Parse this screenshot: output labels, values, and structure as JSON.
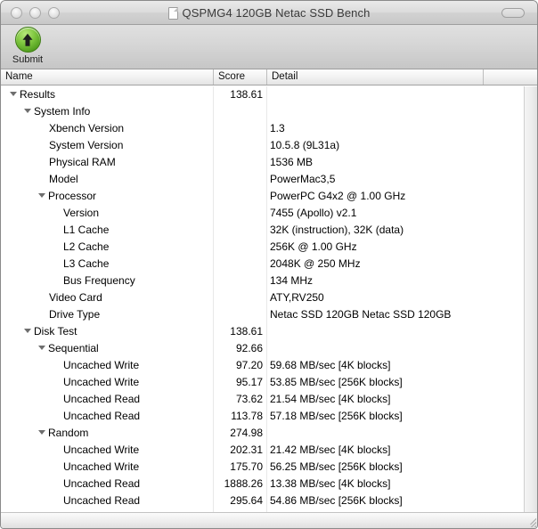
{
  "window": {
    "title": "QSPMG4 120GB Netac SSD Bench",
    "doc_icon": "document-icon",
    "traffic_lights": [
      "close",
      "minimize",
      "zoom"
    ],
    "toolbar_toggle_icon": "toolbar-toggle-icon"
  },
  "toolbar": {
    "submit_label": "Submit",
    "submit_icon": "upload-arrow-icon"
  },
  "columns": {
    "name": "Name",
    "score": "Score",
    "detail": "Detail"
  },
  "rows": [
    {
      "level": 0,
      "expanded": true,
      "name": "Results",
      "score": "138.61",
      "detail": ""
    },
    {
      "level": 1,
      "expanded": true,
      "name": "System Info",
      "score": "",
      "detail": ""
    },
    {
      "level": 2,
      "expanded": null,
      "name": "Xbench Version",
      "score": "",
      "detail": "1.3"
    },
    {
      "level": 2,
      "expanded": null,
      "name": "System Version",
      "score": "",
      "detail": "10.5.8 (9L31a)"
    },
    {
      "level": 2,
      "expanded": null,
      "name": "Physical RAM",
      "score": "",
      "detail": "1536 MB"
    },
    {
      "level": 2,
      "expanded": null,
      "name": "Model",
      "score": "",
      "detail": "PowerMac3,5"
    },
    {
      "level": 2,
      "expanded": true,
      "name": "Processor",
      "score": "",
      "detail": "PowerPC G4x2 @ 1.00 GHz"
    },
    {
      "level": 3,
      "expanded": null,
      "name": "Version",
      "score": "",
      "detail": "7455 (Apollo) v2.1"
    },
    {
      "level": 3,
      "expanded": null,
      "name": "L1 Cache",
      "score": "",
      "detail": "32K (instruction), 32K (data)"
    },
    {
      "level": 3,
      "expanded": null,
      "name": "L2 Cache",
      "score": "",
      "detail": "256K @ 1.00 GHz"
    },
    {
      "level": 3,
      "expanded": null,
      "name": "L3 Cache",
      "score": "",
      "detail": "2048K @ 250 MHz"
    },
    {
      "level": 3,
      "expanded": null,
      "name": "Bus Frequency",
      "score": "",
      "detail": "134 MHz"
    },
    {
      "level": 2,
      "expanded": null,
      "name": "Video Card",
      "score": "",
      "detail": "ATY,RV250"
    },
    {
      "level": 2,
      "expanded": null,
      "name": "Drive Type",
      "score": "",
      "detail": "Netac SSD 120GB Netac SSD 120GB"
    },
    {
      "level": 1,
      "expanded": true,
      "name": "Disk Test",
      "score": "138.61",
      "detail": ""
    },
    {
      "level": 2,
      "expanded": true,
      "name": "Sequential",
      "score": "92.66",
      "detail": ""
    },
    {
      "level": 3,
      "expanded": null,
      "name": "Uncached Write",
      "score": "97.20",
      "detail": "59.68 MB/sec [4K blocks]"
    },
    {
      "level": 3,
      "expanded": null,
      "name": "Uncached Write",
      "score": "95.17",
      "detail": "53.85 MB/sec [256K blocks]"
    },
    {
      "level": 3,
      "expanded": null,
      "name": "Uncached Read",
      "score": "73.62",
      "detail": "21.54 MB/sec [4K blocks]"
    },
    {
      "level": 3,
      "expanded": null,
      "name": "Uncached Read",
      "score": "113.78",
      "detail": "57.18 MB/sec [256K blocks]"
    },
    {
      "level": 2,
      "expanded": true,
      "name": "Random",
      "score": "274.98",
      "detail": ""
    },
    {
      "level": 3,
      "expanded": null,
      "name": "Uncached Write",
      "score": "202.31",
      "detail": "21.42 MB/sec [4K blocks]"
    },
    {
      "level": 3,
      "expanded": null,
      "name": "Uncached Write",
      "score": "175.70",
      "detail": "56.25 MB/sec [256K blocks]"
    },
    {
      "level": 3,
      "expanded": null,
      "name": "Uncached Read",
      "score": "1888.26",
      "detail": "13.38 MB/sec [4K blocks]"
    },
    {
      "level": 3,
      "expanded": null,
      "name": "Uncached Read",
      "score": "295.64",
      "detail": "54.86 MB/sec [256K blocks]"
    }
  ]
}
